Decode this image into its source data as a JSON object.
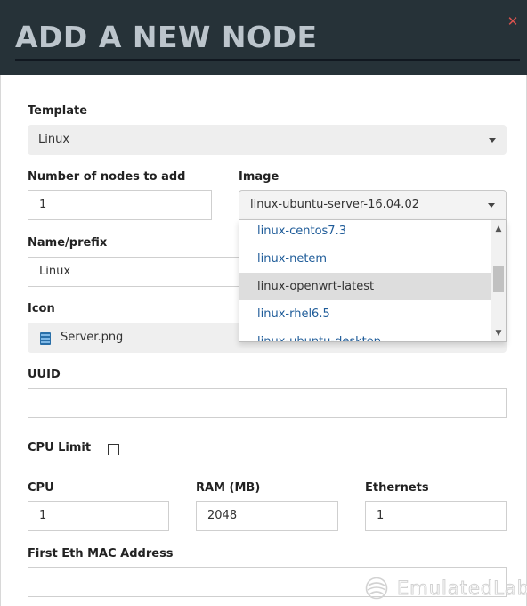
{
  "dialog": {
    "title": "ADD A NEW NODE",
    "close_glyph": "✕"
  },
  "form": {
    "template": {
      "label": "Template",
      "value": "Linux"
    },
    "num_nodes": {
      "label": "Number of nodes to add",
      "value": "1"
    },
    "image": {
      "label": "Image",
      "value": "linux-ubuntu-server-16.04.02",
      "options": [
        "linux-centos7.3",
        "linux-netem",
        "linux-openwrt-latest",
        "linux-rhel6.5",
        "linux-ubuntu-desktop"
      ],
      "highlighted_index": 2
    },
    "name_prefix": {
      "label": "Name/prefix",
      "value": "Linux"
    },
    "icon": {
      "label": "Icon",
      "value": "Server.png",
      "icon_name": "server-icon"
    },
    "uuid": {
      "label": "UUID",
      "value": ""
    },
    "cpu_limit": {
      "label": "CPU Limit",
      "checked": false
    },
    "cpu": {
      "label": "CPU",
      "value": "1"
    },
    "ram": {
      "label": "RAM (MB)",
      "value": "2048"
    },
    "ethernets": {
      "label": "Ethernets",
      "value": "1"
    },
    "mac": {
      "label": "First Eth MAC Address",
      "value": ""
    }
  },
  "watermark": {
    "text": "EmulatedLab"
  },
  "colors": {
    "header_bg": "#263238",
    "header_text": "#bcc5cc",
    "close": "#d9534f",
    "link": "#1f5c99",
    "highlight": "#dddddd"
  }
}
